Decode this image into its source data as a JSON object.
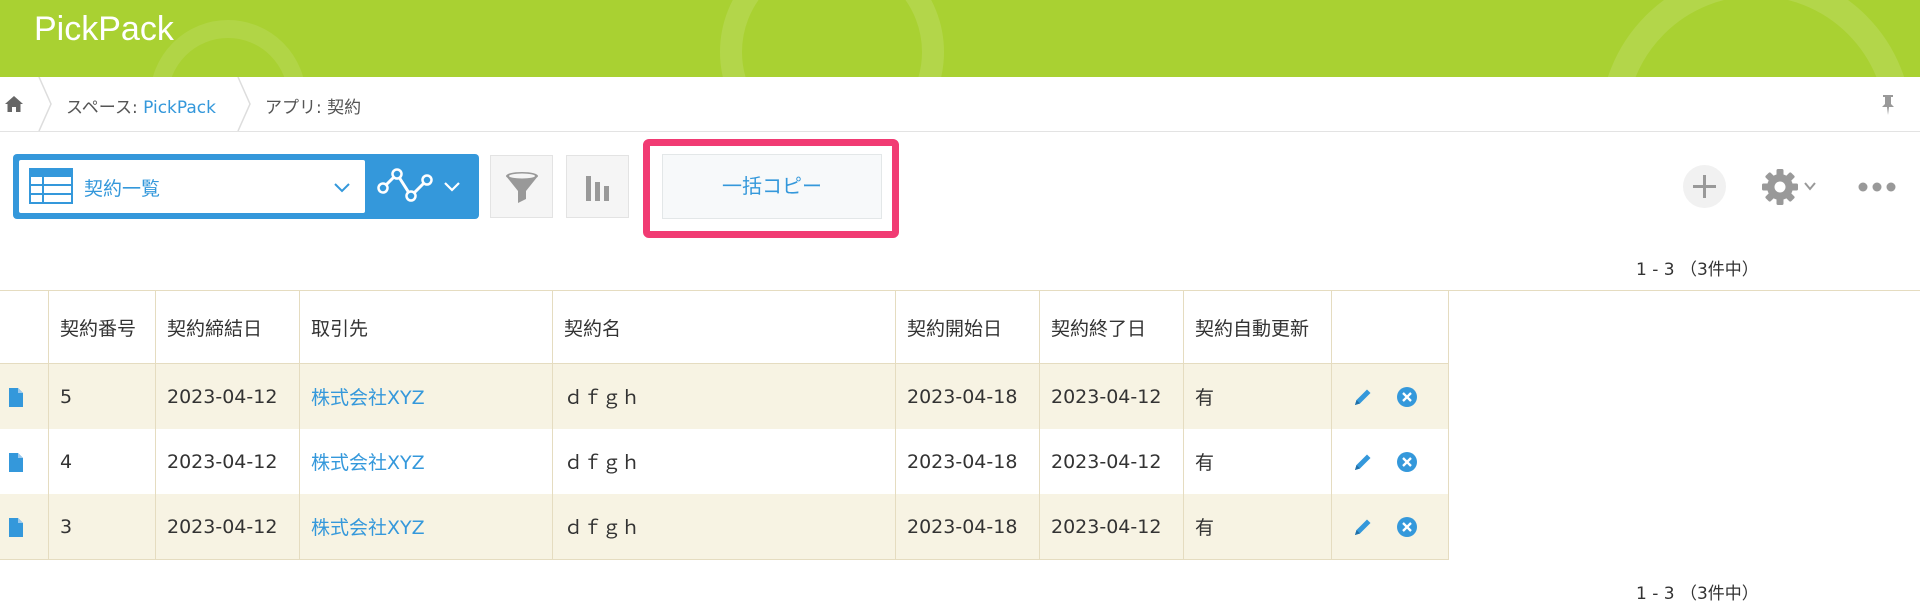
{
  "header": {
    "app_title": "PickPack"
  },
  "breadcrumb": {
    "space_prefix": "スペース: ",
    "space_link": "PickPack",
    "app_label": "アプリ: 契約"
  },
  "toolbar": {
    "view_name": "契約一覧",
    "bulk_copy_label": "一括コピー"
  },
  "pagination": {
    "top": "1 - 3 （3件中）",
    "bottom": "1 - 3 （3件中）"
  },
  "table": {
    "columns": [
      "契約番号",
      "契約締結日",
      "取引先",
      "契約名",
      "契約開始日",
      "契約終了日",
      "契約自動更新"
    ],
    "rows": [
      {
        "no": "5",
        "signed": "2023-04-12",
        "partner": "株式会社XYZ",
        "name": "ｄｆｇｈ",
        "start": "2023-04-18",
        "end": "2023-04-12",
        "auto": "有"
      },
      {
        "no": "4",
        "signed": "2023-04-12",
        "partner": "株式会社XYZ",
        "name": "ｄｆｇｈ",
        "start": "2023-04-18",
        "end": "2023-04-12",
        "auto": "有"
      },
      {
        "no": "3",
        "signed": "2023-04-12",
        "partner": "株式会社XYZ",
        "name": "ｄｆｇｈ",
        "start": "2023-04-18",
        "end": "2023-04-12",
        "auto": "有"
      }
    ]
  },
  "colors": {
    "header_green": "#a9d132",
    "accent_blue": "#3498db",
    "highlight_pink": "#f13b73"
  },
  "icons": [
    "home-icon",
    "pin-icon",
    "table-view-icon",
    "chevron-down-icon",
    "graph-icon",
    "filter-icon",
    "chart-icon",
    "plus-icon",
    "gear-icon",
    "more-icon",
    "record-detail-icon",
    "edit-icon",
    "delete-icon"
  ]
}
